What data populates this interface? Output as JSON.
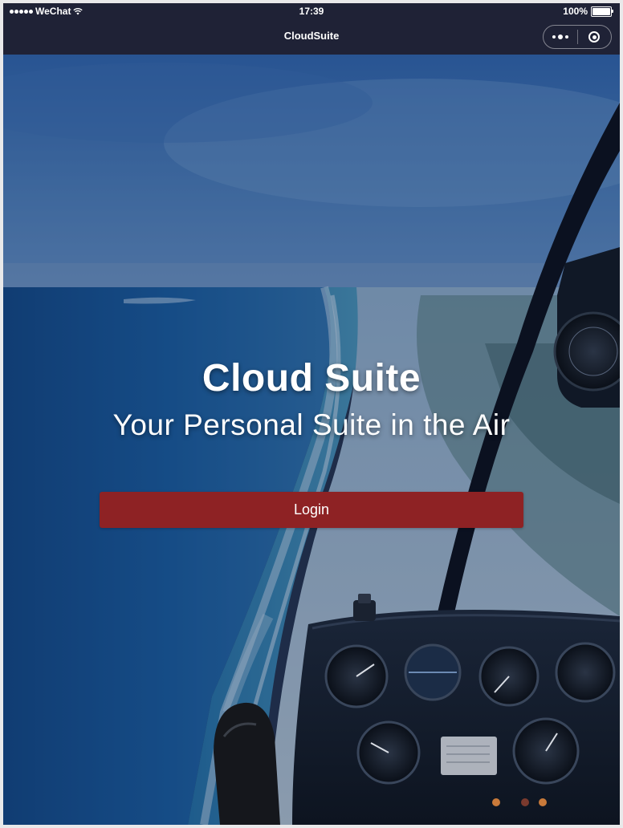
{
  "status_bar": {
    "carrier": "WeChat",
    "time": "17:39",
    "battery_percent": "100%"
  },
  "nav": {
    "title": "CloudSuite",
    "capsule_icons": [
      "more-icon",
      "close-target-icon"
    ]
  },
  "hero": {
    "title": "Cloud Suite",
    "subtitle": "Your Personal Suite in the Air"
  },
  "login": {
    "label": "Login",
    "color": "#8e2224"
  },
  "colors": {
    "nav_background": "#1f2236",
    "overlay": "#1d3a6b"
  },
  "background": {
    "icon": "helicopter-cockpit-coastline-photo"
  }
}
